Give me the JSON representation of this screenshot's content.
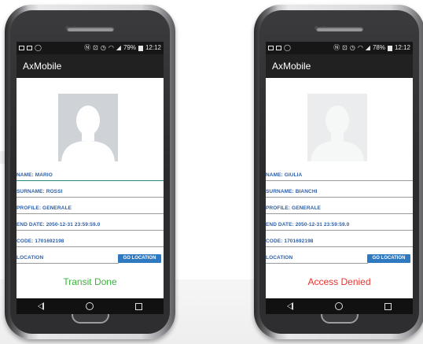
{
  "phones": [
    {
      "statusbar": {
        "battery": "79%",
        "time": "12:12"
      },
      "app_title": "AxMobile",
      "fields": {
        "name": "NAME: MARIO",
        "surname": "SURNAME: ROSSI",
        "profile": "PROFILE: GENERALE",
        "end_date": "END DATE: 2050-12-31 23:59:59.0",
        "code": "CODE: 1701692198",
        "location": "LOCATION"
      },
      "go_location_label": "GO LOCATION",
      "result_text": "Transit Done",
      "result_color": "#3db33d"
    },
    {
      "statusbar": {
        "battery": "78%",
        "time": "12:12"
      },
      "app_title": "AxMobile",
      "fields": {
        "name": "NAME: GIULIA",
        "surname": "SURNAME: BIANCHI",
        "profile": "PROFILE: GENERALE",
        "end_date": "END DATE: 2050-12-31 23:59:59.0",
        "code": "CODE: 1701692198",
        "location": "LOCATION"
      },
      "go_location_label": "GO LOCATION",
      "result_text": "Access Denied",
      "result_color": "#e8332f"
    }
  ],
  "icons": {
    "status_left": [
      "message-icon",
      "image-icon",
      "whatsapp-icon"
    ],
    "status_right": [
      "nfc-icon",
      "vibrate-icon",
      "alarm-icon",
      "wifi-icon",
      "signal-icon",
      "battery-icon"
    ],
    "nav": [
      "back-icon",
      "home-icon",
      "recents-icon"
    ]
  }
}
